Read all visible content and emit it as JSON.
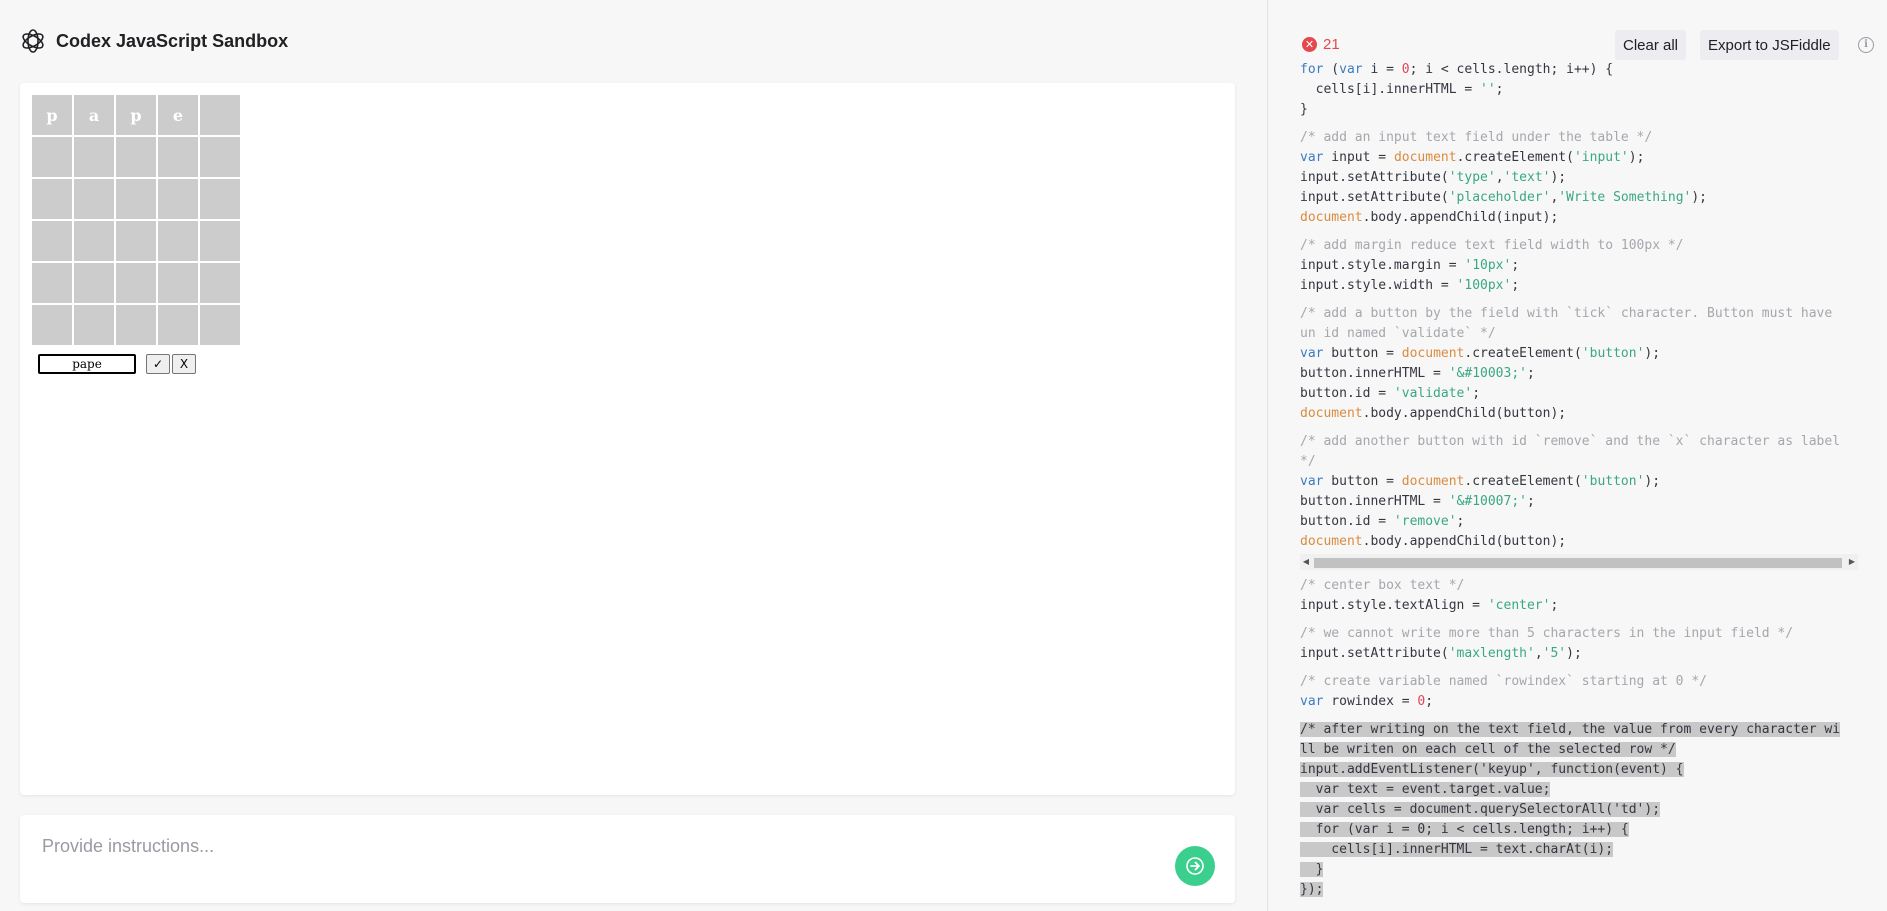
{
  "app": {
    "title": "Codex JavaScript Sandbox"
  },
  "colors": {
    "accent": "#3bcf8e",
    "error": "#e5484d",
    "cell": "#cccccc"
  },
  "preview": {
    "grid": {
      "rows": [
        [
          "p",
          "a",
          "p",
          "e",
          ""
        ],
        [
          "",
          "",
          "",
          "",
          ""
        ],
        [
          "",
          "",
          "",
          "",
          ""
        ],
        [
          "",
          "",
          "",
          "",
          ""
        ],
        [
          "",
          "",
          "",
          "",
          ""
        ],
        [
          "",
          "",
          "",
          "",
          ""
        ]
      ]
    },
    "input_value": "pape",
    "validate_label": "✓",
    "remove_label": "X"
  },
  "prompt": {
    "placeholder": "Provide instructions...",
    "send_icon": "arrow-right-icon"
  },
  "code_panel": {
    "error_count": "21",
    "clear_label": "Clear all",
    "export_label": "Export to JSFiddle",
    "info_icon": "info-icon"
  },
  "code_lines": [
    [
      [
        "k",
        "for"
      ],
      [
        "t",
        " ("
      ],
      [
        "k",
        "var"
      ],
      [
        "t",
        " i = "
      ],
      [
        "n",
        "0"
      ],
      [
        "t",
        "; i < cells.length; i++) {"
      ]
    ],
    [
      [
        "t",
        "  cells[i].innerHTML = "
      ],
      [
        "s",
        "''"
      ],
      [
        "t",
        ";"
      ]
    ],
    [
      [
        "t",
        "}"
      ]
    ],
    "gap",
    [
      [
        "c",
        "/* add an input text field under the table */"
      ]
    ],
    [
      [
        "k",
        "var"
      ],
      [
        "t",
        " input = "
      ],
      [
        "d",
        "document"
      ],
      [
        "t",
        ".createElement("
      ],
      [
        "s",
        "'input'"
      ],
      [
        "t",
        ");"
      ]
    ],
    [
      [
        "t",
        "input.setAttribute("
      ],
      [
        "s",
        "'type'"
      ],
      [
        "t",
        ","
      ],
      [
        "s",
        "'text'"
      ],
      [
        "t",
        ");"
      ]
    ],
    [
      [
        "t",
        "input.setAttribute("
      ],
      [
        "s",
        "'placeholder'"
      ],
      [
        "t",
        ","
      ],
      [
        "s",
        "'Write Something'"
      ],
      [
        "t",
        ");"
      ]
    ],
    [
      [
        "d",
        "document"
      ],
      [
        "t",
        ".body.appendChild(input);"
      ]
    ],
    "gap",
    [
      [
        "c",
        "/* add margin reduce text field width to 100px */"
      ]
    ],
    [
      [
        "t",
        "input.style.margin = "
      ],
      [
        "s",
        "'10px'"
      ],
      [
        "t",
        ";"
      ]
    ],
    [
      [
        "t",
        "input.style.width = "
      ],
      [
        "s",
        "'100px'"
      ],
      [
        "t",
        ";"
      ]
    ],
    "gap",
    [
      [
        "c",
        "/* add a button by the field with `tick` character. Button must have"
      ]
    ],
    [
      [
        "c",
        "un id named `validate` */"
      ]
    ],
    [
      [
        "k",
        "var"
      ],
      [
        "t",
        " button = "
      ],
      [
        "d",
        "document"
      ],
      [
        "t",
        ".createElement("
      ],
      [
        "s",
        "'button'"
      ],
      [
        "t",
        ");"
      ]
    ],
    [
      [
        "t",
        "button.innerHTML = "
      ],
      [
        "s",
        "'&#10003;'"
      ],
      [
        "t",
        ";"
      ]
    ],
    [
      [
        "t",
        "button.id = "
      ],
      [
        "s",
        "'validate'"
      ],
      [
        "t",
        ";"
      ]
    ],
    [
      [
        "d",
        "document"
      ],
      [
        "t",
        ".body.appendChild(button);"
      ]
    ],
    "gap",
    [
      [
        "c",
        "/* add another button with id `remove` and the `x` character as label"
      ]
    ],
    [
      [
        "c",
        "*/"
      ]
    ],
    [
      [
        "k",
        "var"
      ],
      [
        "t",
        " button = "
      ],
      [
        "d",
        "document"
      ],
      [
        "t",
        ".createElement("
      ],
      [
        "s",
        "'button'"
      ],
      [
        "t",
        ");"
      ]
    ],
    [
      [
        "t",
        "button.innerHTML = "
      ],
      [
        "s",
        "'&#10007;'"
      ],
      [
        "t",
        ";"
      ]
    ],
    [
      [
        "t",
        "button.id = "
      ],
      [
        "s",
        "'remove'"
      ],
      [
        "t",
        ";"
      ]
    ],
    [
      [
        "d",
        "document"
      ],
      [
        "t",
        ".body.appendChild(button);"
      ]
    ],
    "scrollbar",
    [
      [
        "c",
        "/* center box text */"
      ]
    ],
    [
      [
        "t",
        "input.style.textAlign = "
      ],
      [
        "s",
        "'center'"
      ],
      [
        "t",
        ";"
      ]
    ],
    "gap",
    [
      [
        "c",
        "/* we cannot write more than 5 characters in the input field */"
      ]
    ],
    [
      [
        "t",
        "input.setAttribute("
      ],
      [
        "s",
        "'maxlength'"
      ],
      [
        "t",
        ","
      ],
      [
        "s",
        "'5'"
      ],
      [
        "t",
        ");"
      ]
    ],
    "gap",
    [
      [
        "c",
        "/* create variable named `rowindex` starting at 0 */"
      ]
    ],
    [
      [
        "k",
        "var"
      ],
      [
        "t",
        " rowindex = "
      ],
      [
        "n",
        "0"
      ],
      [
        "t",
        ";"
      ]
    ],
    "gap",
    {
      "hl": "/* after writing on the text field, the value from every character wi"
    },
    {
      "hl": "ll be writen on each cell of the selected row */"
    },
    {
      "hl": "input.addEventListener('keyup', function(event) {"
    },
    {
      "hl": "  var text = event.target.value;"
    },
    {
      "hl": "  var cells = document.querySelectorAll('td');"
    },
    {
      "hl": "  for (var i = 0; i < cells.length; i++) {"
    },
    {
      "hl": "    cells[i].innerHTML = text.charAt(i);"
    },
    {
      "hl": "  }"
    },
    {
      "hl": "});"
    }
  ]
}
